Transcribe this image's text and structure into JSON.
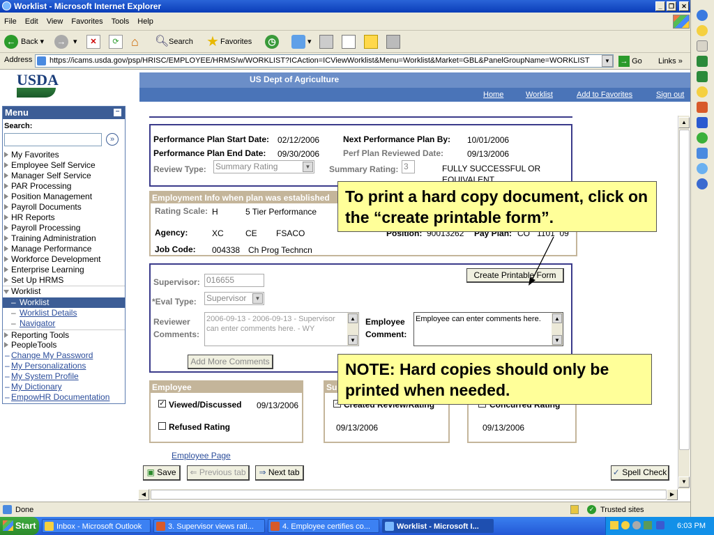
{
  "window": {
    "title": "Worklist - Microsoft Internet Explorer"
  },
  "menubar": [
    "File",
    "Edit",
    "View",
    "Favorites",
    "Tools",
    "Help"
  ],
  "toolbar": {
    "back": "Back",
    "search": "Search",
    "favorites": "Favorites"
  },
  "address": {
    "label": "Address",
    "url": "https://icams.usda.gov/psp/HRISC/EMPLOYEE/HRMS/w/WORKLIST?ICAction=ICViewWorklist&Menu=Worklist&Market=GBL&PanelGroupName=WORKLIST",
    "go": "Go",
    "links": "Links"
  },
  "header": {
    "logo": "USDA",
    "dept": "US Dept of Agriculture",
    "links": [
      "Home",
      "Worklist",
      "Add to Favorites",
      "Sign out"
    ]
  },
  "sidebar": {
    "title": "Menu",
    "search_label": "Search:",
    "items": [
      "My Favorites",
      "Employee Self Service",
      "Manager Self Service",
      "PAR Processing",
      "Position Management",
      "Payroll Documents",
      "HR Reports",
      "Payroll Processing",
      "Training Administration",
      "Manage Performance",
      "Workforce Development",
      "Enterprise Learning",
      "Set Up HRMS",
      "Worklist"
    ],
    "sub_items": [
      "Worklist",
      "Worklist Details",
      "Navigator"
    ],
    "items2": [
      "Reporting Tools",
      "PeopleTools"
    ],
    "links": [
      "Change My Password",
      "My Personalizations",
      "My System Profile",
      "My Dictionary",
      "EmpowHR Documentation"
    ]
  },
  "plan": {
    "start_label": "Performance Plan Start Date:",
    "start": "02/12/2006",
    "next_label": "Next Performance Plan By:",
    "next": "10/01/2006",
    "end_label": "Performance Plan End Date:",
    "end": "09/30/2006",
    "reviewed_label": "Perf Plan Reviewed Date:",
    "reviewed": "09/13/2006",
    "review_type_label": "Review Type:",
    "review_type": "Summary Rating",
    "summary_label": "Summary Rating:",
    "summary_value": "3",
    "summary_text": "FULLY SUCCESSFUL OR EQUIVALENT"
  },
  "employment": {
    "header": "Employment Info when plan was established",
    "rating_scale_label": "Rating Scale:",
    "rating_scale": "H",
    "rating_scale_desc": "5 Tier Performance",
    "agency_label": "Agency:",
    "agency": "XC",
    "agency2": "CE",
    "agency3": "FSACO",
    "position_label": "Position:",
    "position": "90013262",
    "payplan_label": "Pay Plan:",
    "payplan": "CO   1101  09",
    "jobcode_label": "Job Code:",
    "jobcode": "004338",
    "jobcode_desc": "Ch Prog Techncn"
  },
  "review": {
    "create_btn": "Create Printable Form",
    "supervisor_label": "Supervisor:",
    "supervisor": "016655",
    "eval_label": "*Eval Type:",
    "eval": "Supervisor",
    "reviewer_label": "Reviewer",
    "comments_label": "Comments:",
    "reviewer_comment": "2006-09-13 - 2006-09-13 - Supervisor can enter comments here. - WY",
    "employee_label": "Employee",
    "comment_label": "Comment:",
    "employee_comment": "Employee can enter comments here.",
    "add_more": "Add More Comments"
  },
  "employee_box": {
    "header": "Employee",
    "viewed": "Viewed/Discussed",
    "viewed_date": "09/13/2006",
    "refused": "Refused Rating"
  },
  "sup_box": {
    "header": "Su",
    "created": "Created Review/Rating",
    "date": "09/13/2006"
  },
  "con_box": {
    "concurred": "Concurred Rating",
    "date": "09/13/2006"
  },
  "bottom": {
    "employee_page": "Employee Page",
    "save": "Save",
    "prev": "Previous tab",
    "next": "Next tab",
    "spell": "Spell Check"
  },
  "notes": {
    "note1": "To print a hard copy document, click on the “create printable form”.",
    "note2": "NOTE:  Hard copies should only be printed when needed."
  },
  "status": {
    "done": "Done",
    "zone": "Trusted sites"
  },
  "taskbar": {
    "start": "Start",
    "tasks": [
      "Inbox - Microsoft Outlook",
      "3.  Supervisor views rati...",
      "4.  Employee certifies co...",
      "Worklist - Microsoft I..."
    ],
    "time": "6:03 PM"
  }
}
